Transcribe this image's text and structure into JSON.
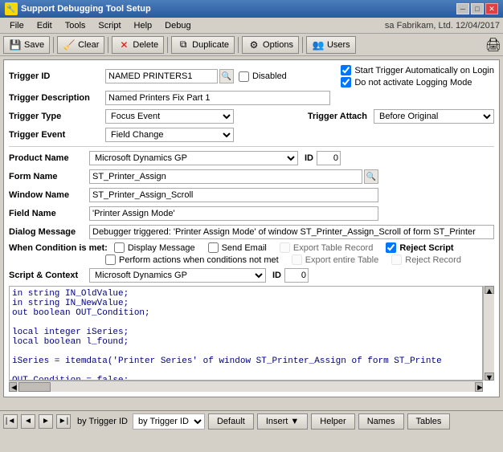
{
  "window": {
    "title": "Support Debugging Tool Setup",
    "icon": "🔧"
  },
  "titlebar": {
    "minimize": "─",
    "maximize": "□",
    "close": "✕"
  },
  "menubar": {
    "items": [
      "File",
      "Edit",
      "Tools",
      "Script",
      "Help",
      "Debug"
    ],
    "user_info": "sa   Fabrikam, Ltd.  12/04/2017"
  },
  "toolbar": {
    "save": "Save",
    "clear": "Clear",
    "delete": "Delete",
    "duplicate": "Duplicate",
    "options": "Options",
    "users": "Users"
  },
  "form": {
    "trigger_id_label": "Trigger ID",
    "trigger_id_value": "NAMED PRINTERS1",
    "disabled_label": "Disabled",
    "trigger_desc_label": "Trigger Description",
    "trigger_desc_value": "Named Printers Fix Part 1",
    "start_trigger_label": "Start Trigger Automatically on Login",
    "do_not_activate_label": "Do not activate Logging Mode",
    "trigger_type_label": "Trigger Type",
    "trigger_type_value": "Focus Event",
    "trigger_event_label": "Trigger Event",
    "trigger_event_value": "Field Change",
    "trigger_attach_label": "Trigger Attach",
    "trigger_attach_value": "Before Original",
    "product_name_label": "Product Name",
    "product_name_value": "Microsoft Dynamics GP",
    "product_id_label": "ID",
    "product_id_value": "0",
    "form_name_label": "Form Name",
    "form_name_value": "ST_Printer_Assign",
    "window_name_label": "Window Name",
    "window_name_value": "ST_Printer_Assign_Scroll",
    "field_name_label": "Field Name",
    "field_name_value": "'Printer Assign Mode'",
    "dialog_message_label": "Dialog Message",
    "dialog_message_value": "Debugger triggered: 'Printer Assign Mode' of window ST_Printer_Assign_Scroll of form ST_Printer",
    "condition_label": "When Condition is met:",
    "display_message_label": "Display Message",
    "send_email_label": "Send Email",
    "export_table_record_label": "Export Table Record",
    "reject_script_label": "Reject Script",
    "perform_actions_label": "Perform actions when conditions not met",
    "export_entire_table_label": "Export entire Table",
    "reject_record_label": "Reject Record",
    "script_context_label": "Script & Context",
    "script_context_value": "Microsoft Dynamics GP",
    "script_id_label": "ID",
    "script_id_value": "0",
    "code_lines": [
      "in string IN_OldValue;",
      "in string IN_NewValue;",
      "out boolean OUT_Condition;",
      "",
      "local integer iSeries;",
      "local boolean l_found;",
      "",
      "iSeries = itemdata('Printer Series' of window ST_Printer_Assign of form ST_Printe",
      "",
      "OUT_Condition = false;"
    ],
    "nav_label": "by Trigger ID",
    "default_btn": "Default",
    "insert_btn": "Insert",
    "helper_btn": "Helper",
    "names_btn": "Names",
    "tables_btn": "Tables"
  }
}
